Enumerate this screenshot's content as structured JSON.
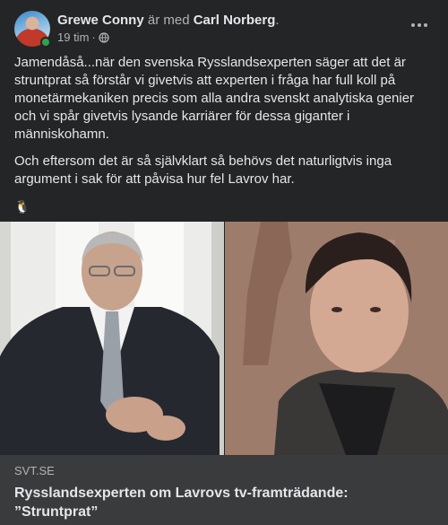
{
  "post": {
    "author": "Grewe Conny",
    "with_text": "är med",
    "tagged": "Carl Norberg",
    "period": ".",
    "time": "19 tim",
    "separator": "·",
    "paragraphs": [
      "Jamendåså...när den svenska Rysslandsexperten säger att det är struntprat så förstår vi givetvis att experten i fråga har full koll på monetärmekaniken precis som alla andra svenskt analytiska genier och vi spår givetvis lysande karriärer för dessa giganter i människohamn.",
      "Och eftersom det är så självklart så behövs det naturligtvis inga argument i sak för att påvisa hur fel Lavrov har."
    ],
    "emoji": "🐧"
  },
  "link": {
    "source": "SVT.SE",
    "title": "Rysslandsexperten om Lavrovs tv-framträdande: ”Struntprat”"
  },
  "colors": {
    "background": "#242526",
    "caption_bg": "#3a3b3c",
    "online": "#31a24c"
  }
}
